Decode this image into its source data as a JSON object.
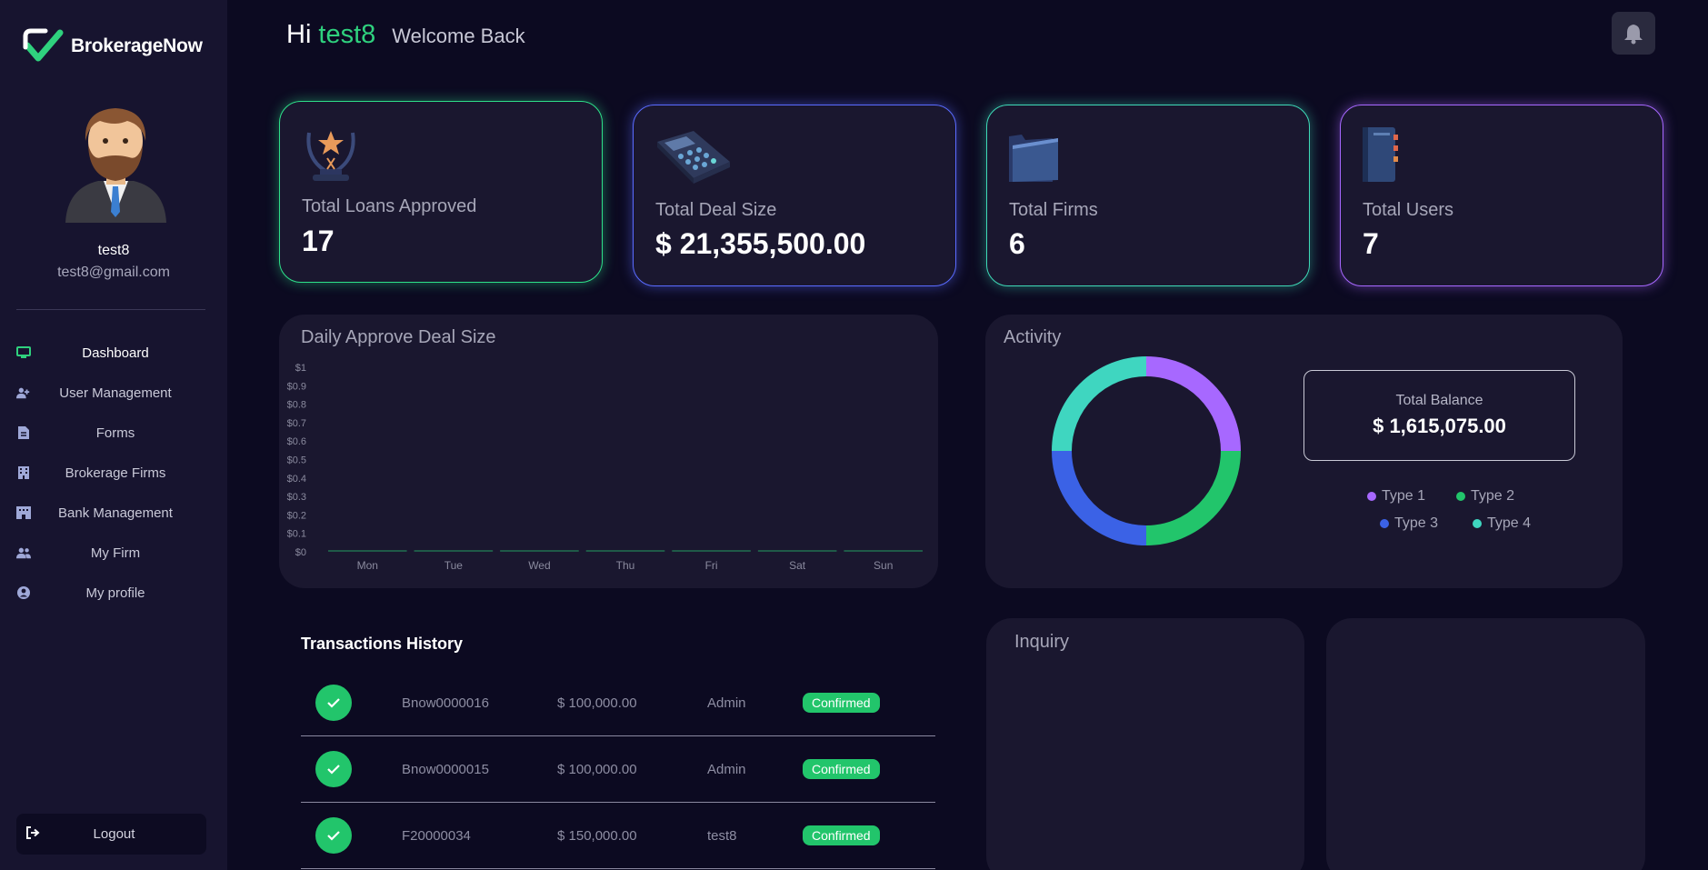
{
  "app": {
    "name": "BrokerageNow"
  },
  "user": {
    "name": "test8",
    "email": "test8@gmail.com"
  },
  "header": {
    "greeting": "Hi",
    "username": "test8",
    "welcome": "Welcome Back"
  },
  "sidebar": {
    "items": [
      {
        "label": "Dashboard",
        "icon": "monitor-icon",
        "active": true
      },
      {
        "label": "User Management",
        "icon": "user-plus-icon"
      },
      {
        "label": "Forms",
        "icon": "document-icon"
      },
      {
        "label": "Brokerage Firms",
        "icon": "building-icon"
      },
      {
        "label": "Bank Management",
        "icon": "bank-building-icon"
      },
      {
        "label": "My Firm",
        "icon": "users-icon"
      },
      {
        "label": "My profile",
        "icon": "user-circle-icon"
      }
    ],
    "logout": "Logout"
  },
  "stats": [
    {
      "label": "Total Loans Approved",
      "value": "17",
      "icon": "trophy-icon",
      "color": "#2ee08a"
    },
    {
      "label": "Total Deal Size",
      "value": "$ 21,355,500.00",
      "icon": "calculator-icon",
      "color": "#5a6bff"
    },
    {
      "label": "Total Firms",
      "value": "6",
      "icon": "folder-icon",
      "color": "#3ed9b7"
    },
    {
      "label": "Total Users",
      "value": "7",
      "icon": "notebook-icon",
      "color": "#a768ff"
    }
  ],
  "daily_chart": {
    "title": "Daily Approve Deal Size"
  },
  "activity": {
    "title": "Activity",
    "balance_label": "Total Balance",
    "balance_value": "$ 1,615,075.00",
    "legend": [
      {
        "name": "Type 1",
        "color": "#a768ff"
      },
      {
        "name": "Type 2",
        "color": "#22c56b"
      },
      {
        "name": "Type 3",
        "color": "#3b62e6"
      },
      {
        "name": "Type 4",
        "color": "#3fd6c0"
      }
    ]
  },
  "transactions": {
    "title": "Transactions History",
    "rows": [
      {
        "id": "Bnow0000016",
        "amount": "$ 100,000.00",
        "user": "Admin",
        "status": "Confirmed"
      },
      {
        "id": "Bnow0000015",
        "amount": "$ 100,000.00",
        "user": "Admin",
        "status": "Confirmed"
      },
      {
        "id": "F20000034",
        "amount": "$ 150,000.00",
        "user": "test8",
        "status": "Confirmed"
      }
    ]
  },
  "inquiry": {
    "title": "Inquiry"
  },
  "chart_data": [
    {
      "type": "bar",
      "title": "Daily Approve Deal Size",
      "categories": [
        "Mon",
        "Tue",
        "Wed",
        "Thu",
        "Fri",
        "Sat",
        "Sun"
      ],
      "values": [
        0,
        0,
        0,
        0,
        0,
        0,
        0
      ],
      "yticks": [
        "$0",
        "$0.1",
        "$0.2",
        "$0.3",
        "$0.4",
        "$0.5",
        "$0.6",
        "$0.7",
        "$0.8",
        "$0.9",
        "$1"
      ],
      "ylim": [
        0,
        1
      ],
      "grid": false,
      "color": "#1f5a48"
    },
    {
      "type": "pie",
      "title": "Activity",
      "categories": [
        "Type 1",
        "Type 2",
        "Type 3",
        "Type 4"
      ],
      "values": [
        25,
        25,
        25,
        25
      ],
      "colors": [
        "#a768ff",
        "#22c56b",
        "#3b62e6",
        "#3fd6c0"
      ]
    }
  ]
}
